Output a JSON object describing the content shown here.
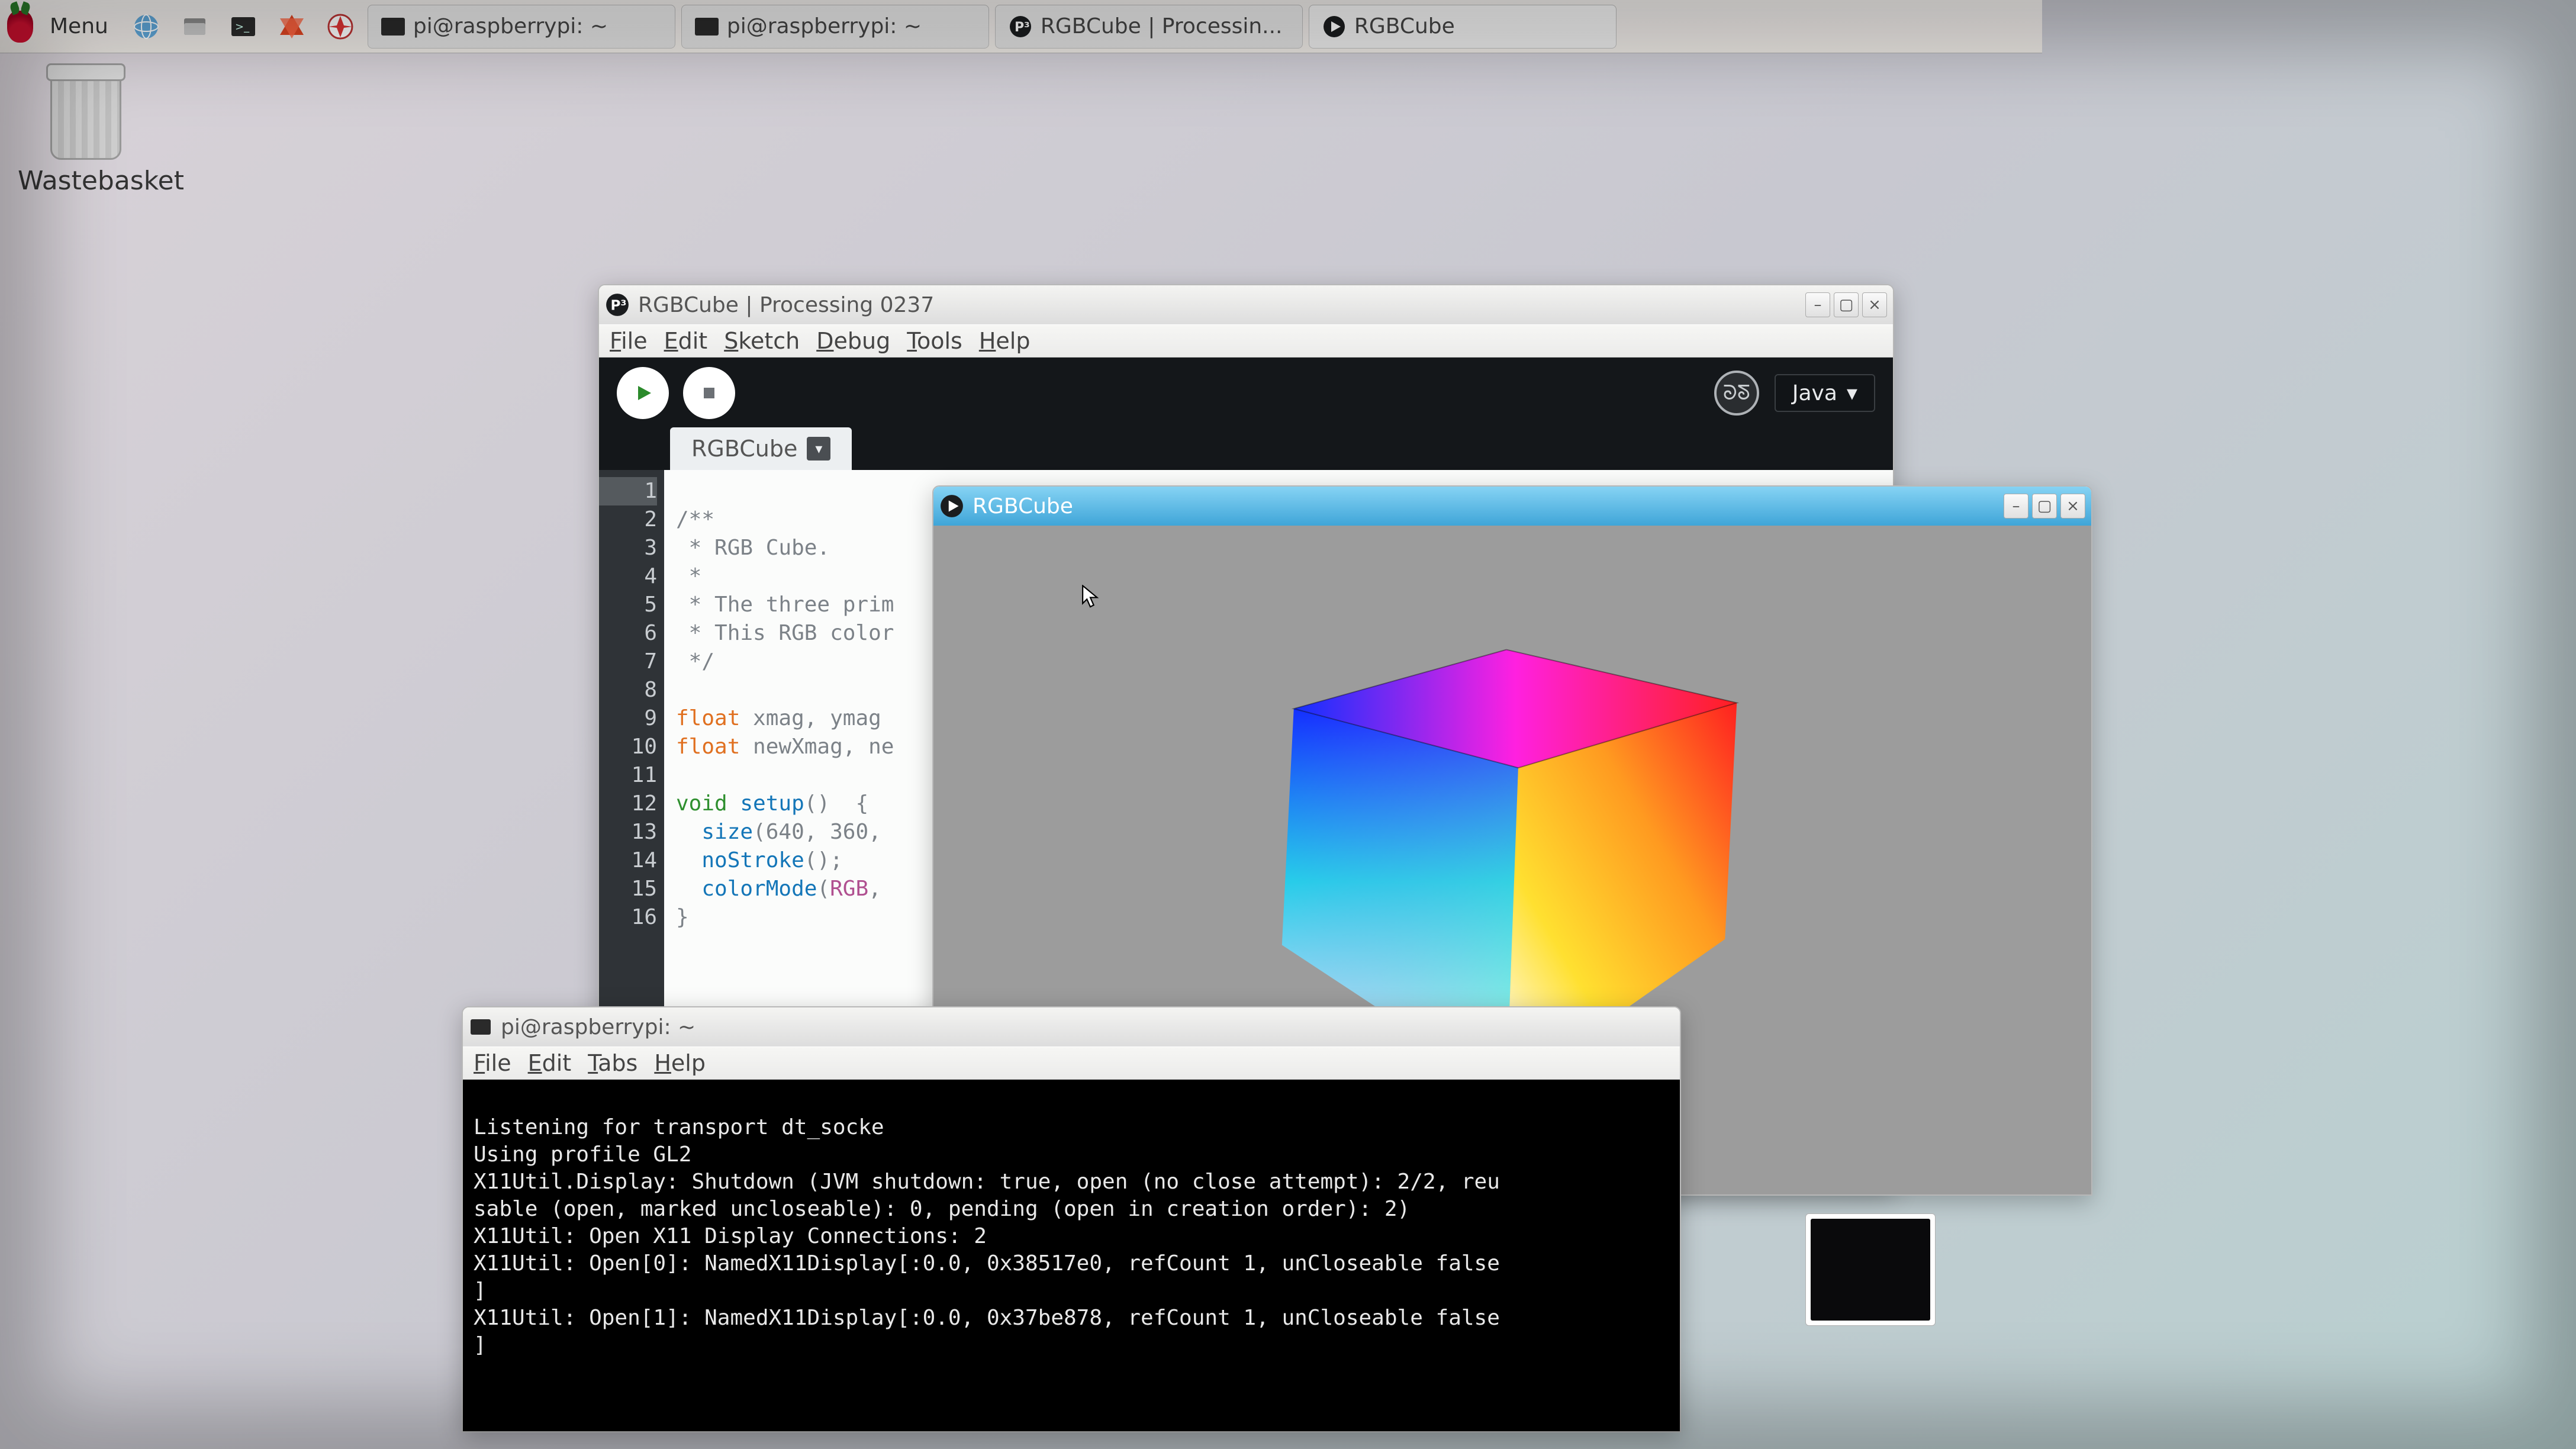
{
  "taskbar": {
    "menu_label": "Menu",
    "entries": [
      {
        "label": "pi@raspberrypi: ~",
        "icon": "terminal"
      },
      {
        "label": "pi@raspberrypi: ~",
        "icon": "terminal"
      },
      {
        "label": "RGBCube | Processin...",
        "icon": "processing"
      },
      {
        "label": "RGBCube",
        "icon": "play"
      }
    ]
  },
  "desktop": {
    "wastebasket_label": "Wastebasket"
  },
  "ide": {
    "title": "RGBCube | Processing 0237",
    "menus": [
      "File",
      "Edit",
      "Sketch",
      "Debug",
      "Tools",
      "Help"
    ],
    "mode_label": "Java",
    "tab_label": "RGBCube",
    "line_numbers": [
      "1",
      "2",
      "3",
      "4",
      "5",
      "6",
      "7",
      "8",
      "9",
      "10",
      "11",
      "12",
      "13",
      "14",
      "15",
      "16"
    ],
    "code": {
      "l1": "/**",
      "l2": " * RGB Cube.",
      "l3": " *",
      "l4": " * The three prim",
      "l5": " * This RGB color",
      "l6": " */",
      "l7": "",
      "l8a": "float",
      "l8b": " xmag, ymag ",
      "l9a": "float",
      "l9b": " newXmag, ne",
      "l10": "",
      "l11a": "void",
      "l11b": " setup",
      "l11c": "()  {",
      "l12a": "  size",
      "l12b": "(640, 360,",
      "l13a": "  noStroke",
      "l13b": "();",
      "l14a": "  colorMode",
      "l14b": "(",
      "l14c": "RGB",
      "l14d": ",",
      "l15": "}"
    }
  },
  "sketch_window": {
    "title": "RGBCube"
  },
  "terminal": {
    "title": "pi@raspberrypi: ~",
    "menus": [
      "File",
      "Edit",
      "Tabs",
      "Help"
    ],
    "lines": [
      "Listening for transport dt_socke",
      "Using profile GL2",
      "X11Util.Display: Shutdown (JVM shutdown: true, open (no close attempt): 2/2, reu",
      "sable (open, marked uncloseable): 0, pending (open in creation order): 2)",
      "X11Util: Open X11 Display Connections: 2",
      "X11Util: Open[0]: NamedX11Display[:0.0, 0x38517e0, refCount 1, unCloseable false",
      "]",
      "X11Util: Open[1]: NamedX11Display[:0.0, 0x37be878, refCount 1, unCloseable false",
      "]"
    ]
  }
}
